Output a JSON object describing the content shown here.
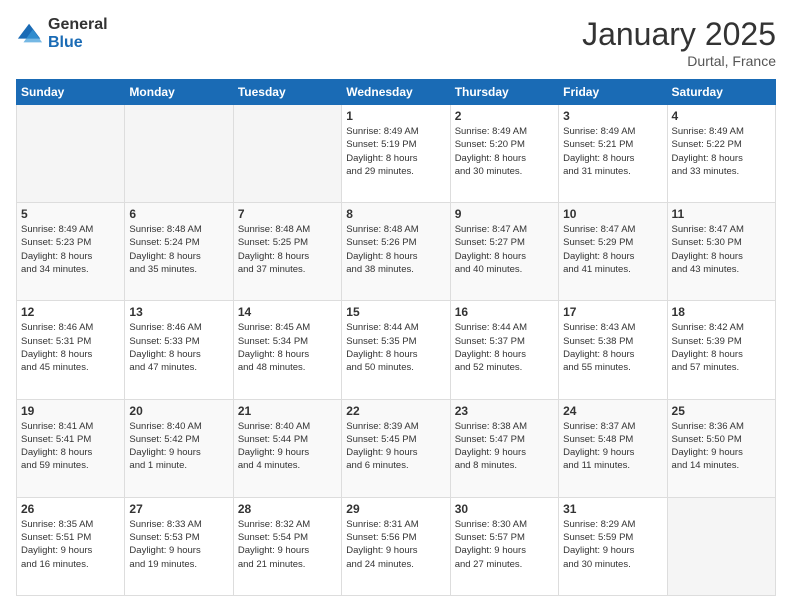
{
  "logo": {
    "general": "General",
    "blue": "Blue"
  },
  "header": {
    "title": "January 2025",
    "location": "Durtal, France"
  },
  "days_of_week": [
    "Sunday",
    "Monday",
    "Tuesday",
    "Wednesday",
    "Thursday",
    "Friday",
    "Saturday"
  ],
  "weeks": [
    [
      {
        "day": "",
        "info": ""
      },
      {
        "day": "",
        "info": ""
      },
      {
        "day": "",
        "info": ""
      },
      {
        "day": "1",
        "info": "Sunrise: 8:49 AM\nSunset: 5:19 PM\nDaylight: 8 hours\nand 29 minutes."
      },
      {
        "day": "2",
        "info": "Sunrise: 8:49 AM\nSunset: 5:20 PM\nDaylight: 8 hours\nand 30 minutes."
      },
      {
        "day": "3",
        "info": "Sunrise: 8:49 AM\nSunset: 5:21 PM\nDaylight: 8 hours\nand 31 minutes."
      },
      {
        "day": "4",
        "info": "Sunrise: 8:49 AM\nSunset: 5:22 PM\nDaylight: 8 hours\nand 33 minutes."
      }
    ],
    [
      {
        "day": "5",
        "info": "Sunrise: 8:49 AM\nSunset: 5:23 PM\nDaylight: 8 hours\nand 34 minutes."
      },
      {
        "day": "6",
        "info": "Sunrise: 8:48 AM\nSunset: 5:24 PM\nDaylight: 8 hours\nand 35 minutes."
      },
      {
        "day": "7",
        "info": "Sunrise: 8:48 AM\nSunset: 5:25 PM\nDaylight: 8 hours\nand 37 minutes."
      },
      {
        "day": "8",
        "info": "Sunrise: 8:48 AM\nSunset: 5:26 PM\nDaylight: 8 hours\nand 38 minutes."
      },
      {
        "day": "9",
        "info": "Sunrise: 8:47 AM\nSunset: 5:27 PM\nDaylight: 8 hours\nand 40 minutes."
      },
      {
        "day": "10",
        "info": "Sunrise: 8:47 AM\nSunset: 5:29 PM\nDaylight: 8 hours\nand 41 minutes."
      },
      {
        "day": "11",
        "info": "Sunrise: 8:47 AM\nSunset: 5:30 PM\nDaylight: 8 hours\nand 43 minutes."
      }
    ],
    [
      {
        "day": "12",
        "info": "Sunrise: 8:46 AM\nSunset: 5:31 PM\nDaylight: 8 hours\nand 45 minutes."
      },
      {
        "day": "13",
        "info": "Sunrise: 8:46 AM\nSunset: 5:33 PM\nDaylight: 8 hours\nand 47 minutes."
      },
      {
        "day": "14",
        "info": "Sunrise: 8:45 AM\nSunset: 5:34 PM\nDaylight: 8 hours\nand 48 minutes."
      },
      {
        "day": "15",
        "info": "Sunrise: 8:44 AM\nSunset: 5:35 PM\nDaylight: 8 hours\nand 50 minutes."
      },
      {
        "day": "16",
        "info": "Sunrise: 8:44 AM\nSunset: 5:37 PM\nDaylight: 8 hours\nand 52 minutes."
      },
      {
        "day": "17",
        "info": "Sunrise: 8:43 AM\nSunset: 5:38 PM\nDaylight: 8 hours\nand 55 minutes."
      },
      {
        "day": "18",
        "info": "Sunrise: 8:42 AM\nSunset: 5:39 PM\nDaylight: 8 hours\nand 57 minutes."
      }
    ],
    [
      {
        "day": "19",
        "info": "Sunrise: 8:41 AM\nSunset: 5:41 PM\nDaylight: 8 hours\nand 59 minutes."
      },
      {
        "day": "20",
        "info": "Sunrise: 8:40 AM\nSunset: 5:42 PM\nDaylight: 9 hours\nand 1 minute."
      },
      {
        "day": "21",
        "info": "Sunrise: 8:40 AM\nSunset: 5:44 PM\nDaylight: 9 hours\nand 4 minutes."
      },
      {
        "day": "22",
        "info": "Sunrise: 8:39 AM\nSunset: 5:45 PM\nDaylight: 9 hours\nand 6 minutes."
      },
      {
        "day": "23",
        "info": "Sunrise: 8:38 AM\nSunset: 5:47 PM\nDaylight: 9 hours\nand 8 minutes."
      },
      {
        "day": "24",
        "info": "Sunrise: 8:37 AM\nSunset: 5:48 PM\nDaylight: 9 hours\nand 11 minutes."
      },
      {
        "day": "25",
        "info": "Sunrise: 8:36 AM\nSunset: 5:50 PM\nDaylight: 9 hours\nand 14 minutes."
      }
    ],
    [
      {
        "day": "26",
        "info": "Sunrise: 8:35 AM\nSunset: 5:51 PM\nDaylight: 9 hours\nand 16 minutes."
      },
      {
        "day": "27",
        "info": "Sunrise: 8:33 AM\nSunset: 5:53 PM\nDaylight: 9 hours\nand 19 minutes."
      },
      {
        "day": "28",
        "info": "Sunrise: 8:32 AM\nSunset: 5:54 PM\nDaylight: 9 hours\nand 21 minutes."
      },
      {
        "day": "29",
        "info": "Sunrise: 8:31 AM\nSunset: 5:56 PM\nDaylight: 9 hours\nand 24 minutes."
      },
      {
        "day": "30",
        "info": "Sunrise: 8:30 AM\nSunset: 5:57 PM\nDaylight: 9 hours\nand 27 minutes."
      },
      {
        "day": "31",
        "info": "Sunrise: 8:29 AM\nSunset: 5:59 PM\nDaylight: 9 hours\nand 30 minutes."
      },
      {
        "day": "",
        "info": ""
      }
    ]
  ]
}
